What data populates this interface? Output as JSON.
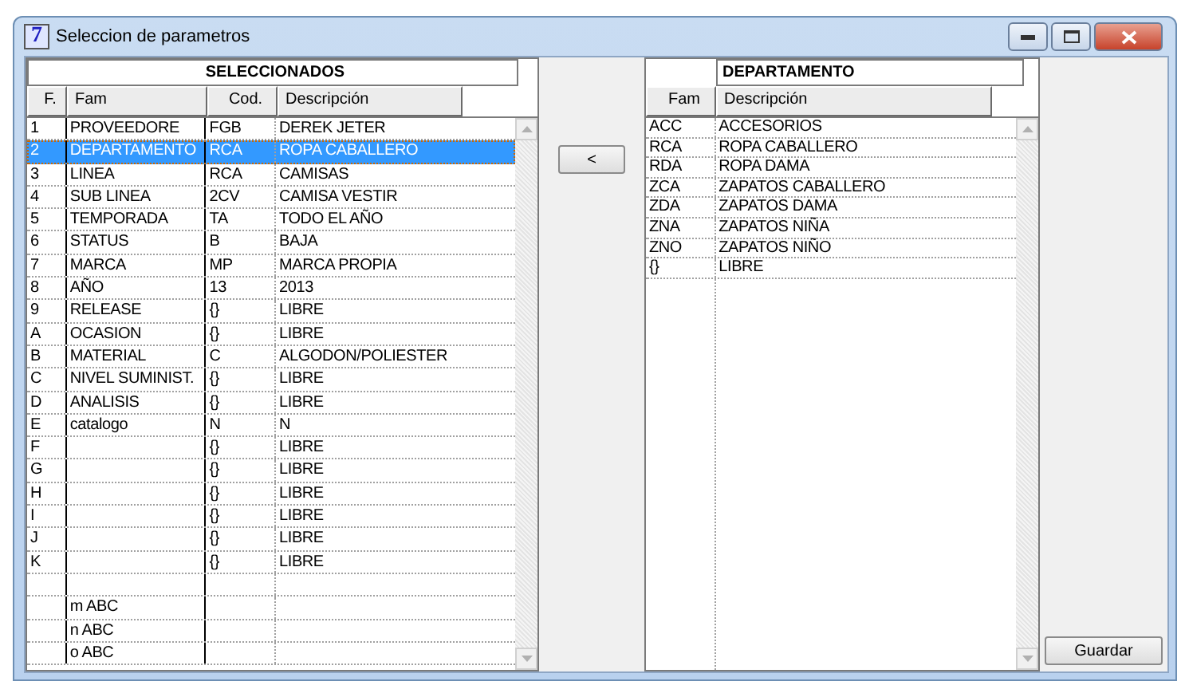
{
  "window": {
    "icon_text": "7",
    "title": "Seleccion de parametros"
  },
  "selected_grid": {
    "title": "SELECCIONADOS",
    "columns": [
      "F.",
      "Fam",
      "Cod.",
      "Descripción"
    ],
    "rows": [
      {
        "f": "1",
        "fam": "PROVEEDORE",
        "cod": "FGB",
        "desc": "DEREK JETER",
        "selected": false
      },
      {
        "f": "2",
        "fam": "DEPARTAMENTO",
        "cod": "RCA",
        "desc": "ROPA CABALLERO",
        "selected": true
      },
      {
        "f": "3",
        "fam": "LINEA",
        "cod": "RCA",
        "desc": "CAMISAS",
        "selected": false
      },
      {
        "f": "4",
        "fam": "SUB LINEA",
        "cod": "2CV",
        "desc": "CAMISA VESTIR",
        "selected": false
      },
      {
        "f": "5",
        "fam": "TEMPORADA",
        "cod": "TA",
        "desc": "TODO EL AÑO",
        "selected": false
      },
      {
        "f": "6",
        "fam": "STATUS",
        "cod": "B",
        "desc": "BAJA",
        "selected": false
      },
      {
        "f": "7",
        "fam": "MARCA",
        "cod": "MP",
        "desc": "MARCA PROPIA",
        "selected": false
      },
      {
        "f": "8",
        "fam": "AÑO",
        "cod": "13",
        "desc": "2013",
        "selected": false
      },
      {
        "f": "9",
        "fam": "RELEASE",
        "cod": "{}",
        "desc": "LIBRE",
        "selected": false
      },
      {
        "f": "A",
        "fam": "OCASION",
        "cod": "{}",
        "desc": "LIBRE",
        "selected": false
      },
      {
        "f": "B",
        "fam": "MATERIAL",
        "cod": "C",
        "desc": "ALGODON/POLIESTER",
        "selected": false
      },
      {
        "f": "C",
        "fam": "NIVEL SUMINIST.",
        "cod": "{}",
        "desc": "LIBRE",
        "selected": false
      },
      {
        "f": "D",
        "fam": "ANALISIS",
        "cod": "{}",
        "desc": "LIBRE",
        "selected": false
      },
      {
        "f": "E",
        "fam": "catalogo",
        "cod": "N",
        "desc": "N",
        "selected": false
      },
      {
        "f": "F",
        "cod": "{}",
        "desc": "LIBRE",
        "selected": false
      },
      {
        "f": "G",
        "cod": "{}",
        "desc": "LIBRE",
        "selected": false
      },
      {
        "f": "H",
        "cod": "{}",
        "desc": "LIBRE",
        "selected": false
      },
      {
        "f": "I",
        "cod": "{}",
        "desc": "LIBRE",
        "selected": false
      },
      {
        "f": "J",
        "cod": "{}",
        "desc": "LIBRE",
        "selected": false
      },
      {
        "f": "K",
        "cod": "{}",
        "desc": "LIBRE",
        "selected": false
      },
      {
        "selected": false
      },
      {
        "fam": "m ABC",
        "selected": false
      },
      {
        "fam": "n ABC",
        "selected": false
      },
      {
        "fam": "o ABC",
        "selected": false
      }
    ]
  },
  "move_button": {
    "label": "<"
  },
  "options_grid": {
    "title": "DEPARTAMENTO",
    "columns": [
      "Fam",
      "Descripción"
    ],
    "rows": [
      {
        "fam": "ACC",
        "desc": "ACCESORIOS"
      },
      {
        "fam": "RCA",
        "desc": "ROPA CABALLERO"
      },
      {
        "fam": "RDA",
        "desc": "ROPA DAMA"
      },
      {
        "fam": "ZCA",
        "desc": "ZAPATOS CABALLERO"
      },
      {
        "fam": "ZDA",
        "desc": "ZAPATOS DAMA"
      },
      {
        "fam": "ZNA",
        "desc": "ZAPATOS NIÑA"
      },
      {
        "fam": "ZNO",
        "desc": "ZAPATOS NIÑO"
      },
      {
        "fam": "{}",
        "desc": "LIBRE"
      }
    ]
  },
  "save_button": {
    "label": "Guardar"
  }
}
